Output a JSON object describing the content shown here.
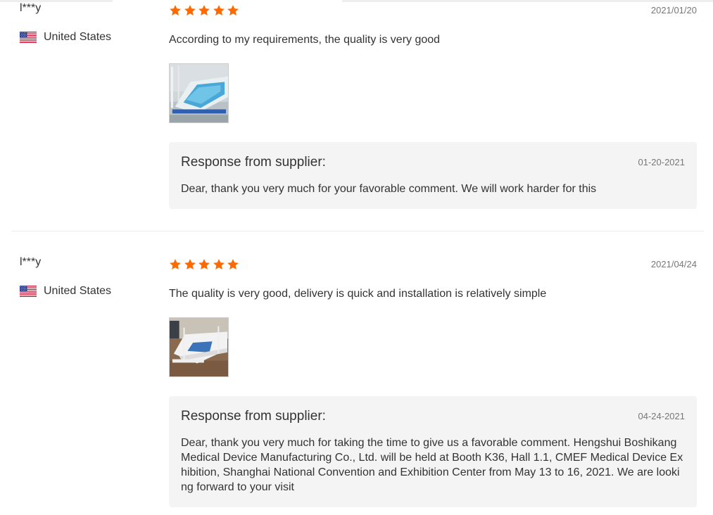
{
  "reviews": [
    {
      "user": "l***y",
      "country": "United States",
      "rating": 5,
      "date": "2021/01/20",
      "comment": "According to my requirements, the quality is very good",
      "response": {
        "title": "Response from supplier:",
        "date": "01-20-2021",
        "text": "Dear, thank you very much for your favorable comment. We will work harder for this"
      }
    },
    {
      "user": "l***y",
      "country": "United States",
      "rating": 5,
      "date": "2021/04/24",
      "comment": "The quality is very good, delivery is quick and installation is relatively simple",
      "response": {
        "title": "Response from supplier:",
        "date": "04-24-2021",
        "text": "Dear, thank you very much for taking the time to give us a favorable comment. Hengshui Boshikang Medical Device Manufacturing Co., Ltd. will be held at Booth K36, Hall 1.1, CMEF Medical Device Exhibition, Shanghai National Convention and Exhibition Center from May 13 to 16, 2021. We are looking forward to your visit"
      }
    }
  ],
  "colors": {
    "star": "#ff6a00",
    "response_bg": "#f4f4f4"
  },
  "icons": {
    "flag": "us-flag-icon",
    "star": "star-icon"
  }
}
